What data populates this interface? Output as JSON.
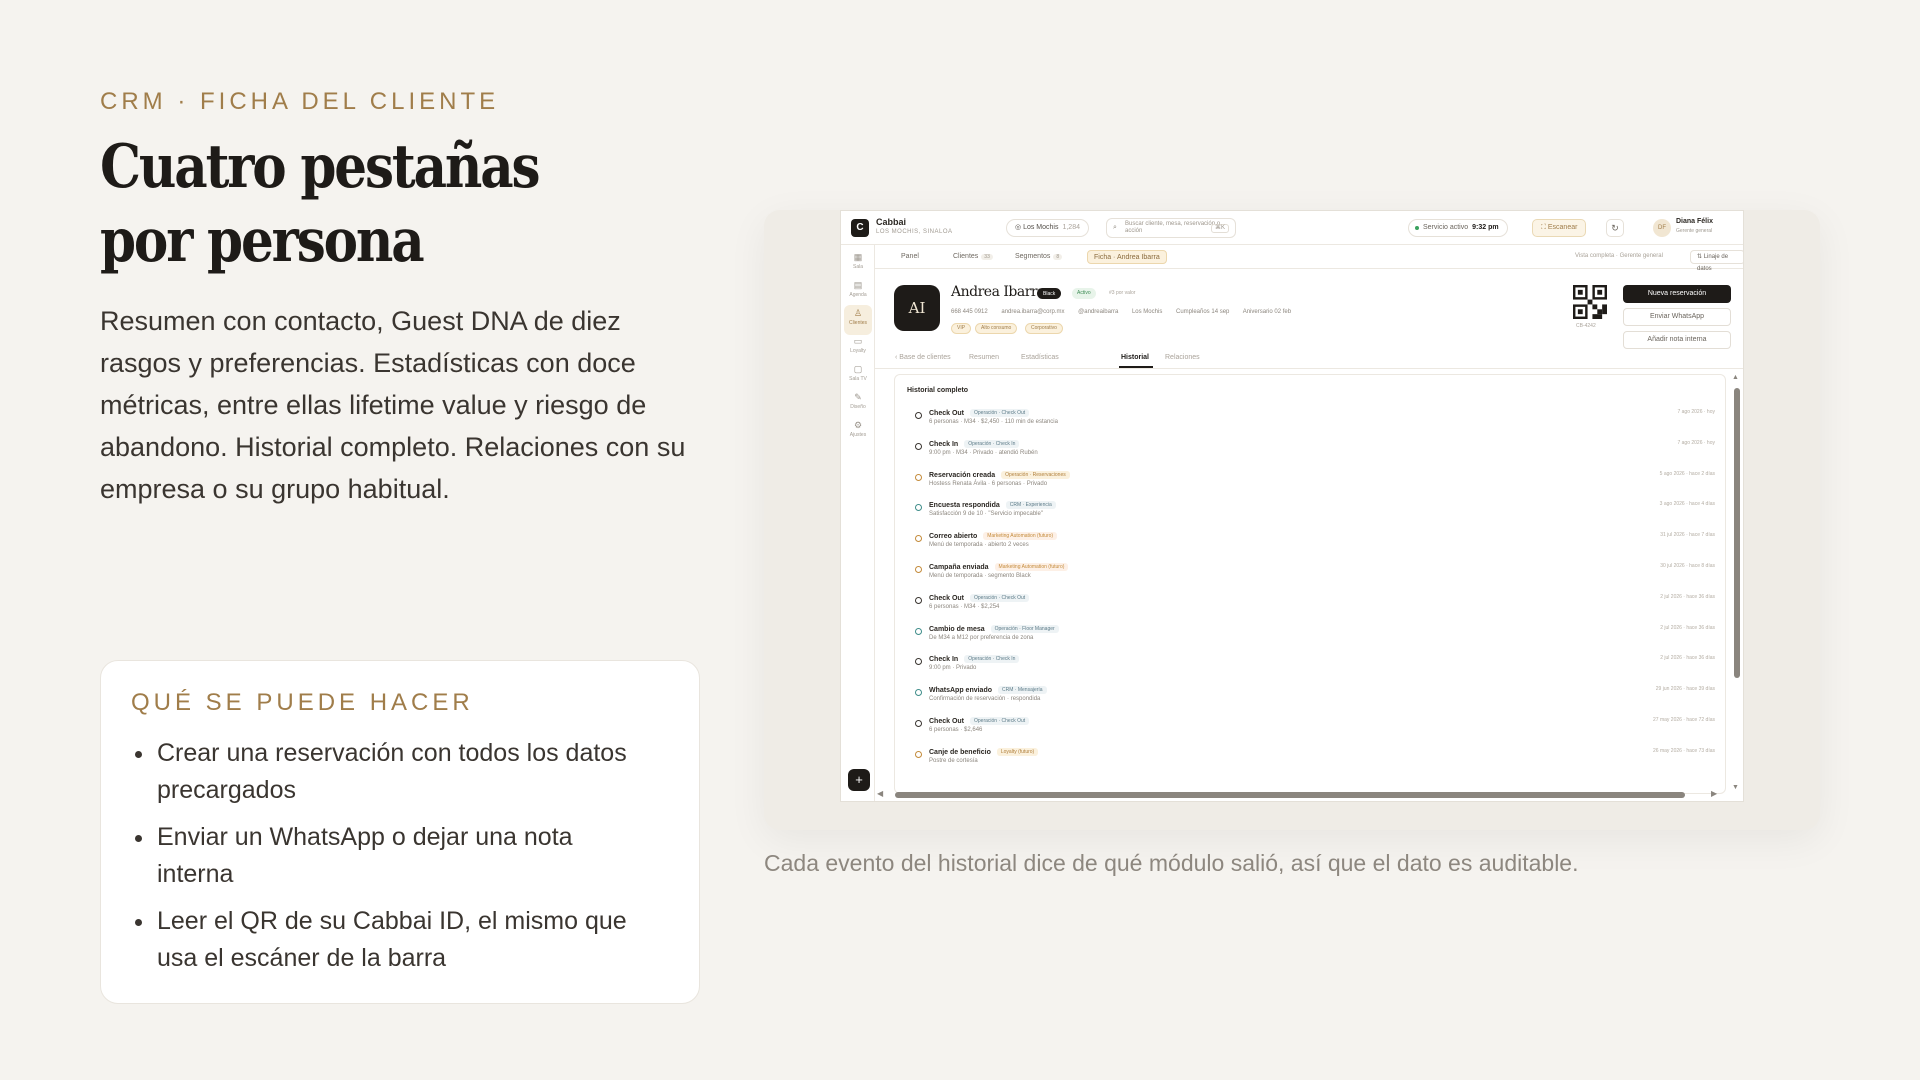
{
  "slide": {
    "eyebrow": "CRM · FICHA DEL CLIENTE",
    "headline_line1": "Cuatro pestañas",
    "headline_line2": "por persona",
    "intro": "Resumen con contacto, Guest DNA de diez rasgos y preferencias. Estadísticas con doce métricas, entre ellas lifetime value y riesgo de abandono. Historial completo. Relaciones con su empresa o su grupo habitual.",
    "card_title": "QUÉ SE PUEDE HACER",
    "bullets": [
      "Crear una reservación con todos los datos precargados",
      "Enviar un WhatsApp o dejar una nota interna",
      "Leer el QR de su Cabbai ID, el mismo que usa el escáner de la barra"
    ],
    "caption": "Cada evento del historial dice de qué módulo salió, así que el dato es auditable."
  },
  "app": {
    "logo_letter": "C",
    "brand": "Cabbai",
    "brand_sub": "LOS MOCHIS, SINALOA",
    "location": "Los Mochis",
    "location_count": "1,284",
    "search_placeholder": "Buscar cliente, mesa, reservación o acción",
    "search_kbd": "⌘K",
    "status_label": "Servicio activo",
    "status_time": "9:32 pm",
    "scan_label": "Escanear",
    "user_initials": "DF",
    "user_name": "Diana Félix",
    "user_role": "Gerente general",
    "sidebar": [
      {
        "icon": "▦",
        "label": "Sala"
      },
      {
        "icon": "▤",
        "label": "Agenda"
      },
      {
        "icon": "♙",
        "label": "Clientes"
      },
      {
        "icon": "▭",
        "label": "Loyalty"
      },
      {
        "icon": "▢",
        "label": "Sala TV"
      },
      {
        "icon": "✎",
        "label": "Diseño"
      },
      {
        "icon": "⚙",
        "label": "Ajustes"
      }
    ],
    "fab": "+",
    "nav": {
      "panel": "Panel",
      "clientes": "Clientes",
      "clientes_count": "33",
      "segmentos": "Segmentos",
      "segmentos_count": "8",
      "current": "Ficha · Andrea Ibarra",
      "vista": "Vista completa · Gerente general",
      "linaje": "Linaje de datos"
    },
    "profile": {
      "initials": "AI",
      "name": "Andrea Ibarra",
      "tier": "Black",
      "status": "Activo",
      "value_note": "#3 por valor",
      "phone": "668 445 0912",
      "email": "andrea.ibarra@corp.mx",
      "handle": "@andreaibarra",
      "city": "Los Mochis",
      "birthday": "Cumpleaños 14 sep",
      "anniversary": "Aniversario 02 feb",
      "tags": [
        "VIP",
        "Alto consumo",
        "Corporativo"
      ],
      "qr_id": "CB-4242"
    },
    "actions": {
      "new_reservation": "Nueva reservación",
      "whatsapp": "Enviar WhatsApp",
      "note": "Añadir nota interna"
    },
    "subtabs": {
      "back": "‹ Base de clientes",
      "resumen": "Resumen",
      "estadisticas": "Estadísticas",
      "historial": "Historial",
      "relaciones": "Relaciones"
    },
    "history_title": "Historial completo",
    "events": [
      {
        "title": "Check Out",
        "badge": "Operación · Check Out",
        "kind": "op",
        "desc": "6 personas · M34 · $2,450 · 110 min de estancia",
        "when": "7 ago 2026 · hoy",
        "dot": ""
      },
      {
        "title": "Check In",
        "badge": "Operación · Check In",
        "kind": "op",
        "desc": "9:00 pm · M34 · Privado · atendió Rubén",
        "when": "7 ago 2026 · hoy",
        "dot": ""
      },
      {
        "title": "Reservación creada",
        "badge": "Operación · Reservaciones",
        "kind": "res",
        "desc": "Hostess Renata Ávila · 6 personas · Privado",
        "when": "5 ago 2026 · hace 2 días",
        "dot": "warm"
      },
      {
        "title": "Encuesta respondida",
        "badge": "CRM · Experiencia",
        "kind": "crm",
        "desc": "Satisfacción 9 de 10 · \"Servicio impecable\"",
        "when": "3 ago 2026 · hace 4 días",
        "dot": "teal"
      },
      {
        "title": "Correo abierto",
        "badge": "Marketing Automation (futuro)",
        "kind": "mkt",
        "desc": "Menú de temporada · abierto 2 veces",
        "when": "31 jul 2026 · hace 7 días",
        "dot": "warm"
      },
      {
        "title": "Campaña enviada",
        "badge": "Marketing Automation (futuro)",
        "kind": "mkt",
        "desc": "Menú de temporada · segmento Black",
        "when": "30 jul 2026 · hace 8 días",
        "dot": "warm"
      },
      {
        "title": "Check Out",
        "badge": "Operación · Check Out",
        "kind": "op",
        "desc": "6 personas · M34 · $2,254",
        "when": "2 jul 2026 · hace 36 días",
        "dot": ""
      },
      {
        "title": "Cambio de mesa",
        "badge": "Operación · Floor Manager",
        "kind": "op",
        "desc": "De M34 a M12 por preferencia de zona",
        "when": "2 jul 2026 · hace 36 días",
        "dot": "teal"
      },
      {
        "title": "Check In",
        "badge": "Operación · Check In",
        "kind": "op",
        "desc": "9:00 pm · Privado",
        "when": "2 jul 2026 · hace 36 días",
        "dot": ""
      },
      {
        "title": "WhatsApp enviado",
        "badge": "CRM · Mensajería",
        "kind": "crm",
        "desc": "Confirmación de reservación · respondida",
        "when": "29 jun 2026 · hace 39 días",
        "dot": "teal"
      },
      {
        "title": "Check Out",
        "badge": "Operación · Check Out",
        "kind": "op",
        "desc": "6 personas · $2,646",
        "when": "27 may 2026 · hace 72 días",
        "dot": ""
      },
      {
        "title": "Canje de beneficio",
        "badge": "Loyalty (futuro)",
        "kind": "loy",
        "desc": "Postre de cortesía",
        "when": "26 may 2026 · hace 73 días",
        "dot": "warm"
      }
    ]
  }
}
